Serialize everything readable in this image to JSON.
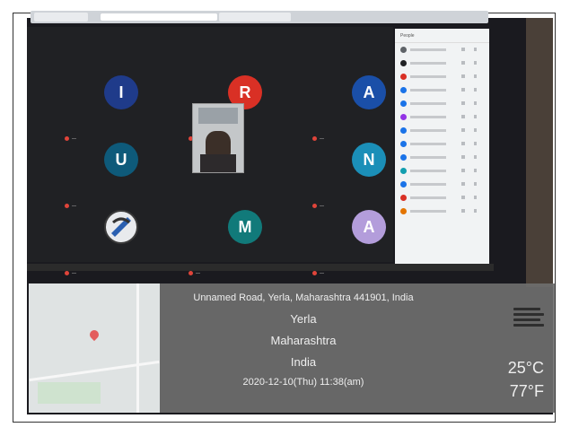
{
  "meet": {
    "tiles": [
      {
        "initial": "I",
        "color": "#1f3b8a",
        "name": "—"
      },
      {
        "initial": "R",
        "color": "#d93025",
        "name": "—"
      },
      {
        "initial": "A",
        "color": "#1a4fa8",
        "name": "—"
      },
      {
        "initial": "U",
        "color": "#0e5a7a",
        "name": "—"
      },
      {
        "initial": "N",
        "color": "#1b8fb8",
        "name": "—"
      },
      {
        "initial": "",
        "color": "#e8eaed",
        "name": "—"
      },
      {
        "initial": "M",
        "color": "#117a7a",
        "name": "—"
      },
      {
        "initial": "A",
        "color": "#b39ddb",
        "name": "—"
      }
    ],
    "people_panel_title": "People"
  },
  "location": {
    "address": "Unnamed Road, Yerla, Maharashtra 441901, India",
    "city": "Yerla",
    "state": "Maharashtra",
    "country": "India",
    "datetime": "2020-12-10(Thu)  11:38(am)",
    "temp_c": "25°C",
    "temp_f": "77°F"
  }
}
